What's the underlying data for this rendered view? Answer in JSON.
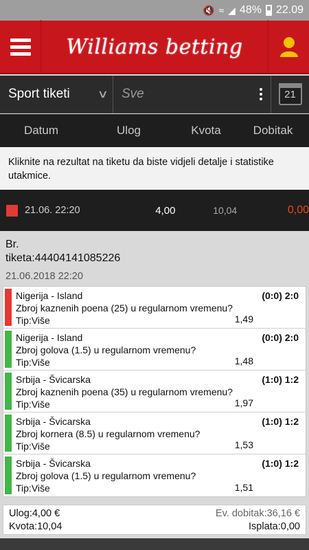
{
  "status_bar": {
    "battery": "48%",
    "time": "22.09"
  },
  "header": {
    "brand": "Williams betting",
    "brand_color": "#c8161d"
  },
  "filter": {
    "sport": "Sport tiketi",
    "placeholder": "Sve",
    "calendar_day": "21"
  },
  "columns": {
    "date": "Datum",
    "stake": "Ulog",
    "odds": "Kvota",
    "winnings": "Dobitak"
  },
  "info_text": "Kliknite na rezultat na tiketu da biste vidjeli detalje i statistike utakmice.",
  "ticket_row": {
    "date": "21.06. 22:20",
    "stake": "4,00",
    "odds": "10,04",
    "winnings": "0,00",
    "status_color": "#e53935"
  },
  "ticket": {
    "number_label": "Br.",
    "number": "tiketa:44404141085226",
    "datetime": "21.06.2018 22:20"
  },
  "bets": [
    {
      "match": "Nigerija - Island",
      "market": "Zbroj kaznenih poena (25) u regularnom vremenu?",
      "tip": "Tip:Više",
      "score": "(0:0) 2:0",
      "odds": "1,49",
      "color": "#e53935"
    },
    {
      "match": "Nigerija - Island",
      "market": "Zbroj golova (1.5) u regularnom vremenu?",
      "tip": "Tip:Više",
      "score": "(0:0) 2:0",
      "odds": "1,48",
      "color": "#43b649"
    },
    {
      "match": "Srbija - Švicarska",
      "market": "Zbroj kaznenih poena (35) u regularnom vremenu?",
      "tip": "Tip:Više",
      "score": "(1:0) 1:2",
      "odds": "1,97",
      "color": "#43b649"
    },
    {
      "match": "Srbija - Švicarska",
      "market": "Zbroj kornera (8.5) u regularnom vremenu?",
      "tip": "Tip:Više",
      "score": "(1:0) 1:2",
      "odds": "1,53",
      "color": "#43b649"
    },
    {
      "match": "Srbija - Švicarska",
      "market": "Zbroj golova (1.5) u regularnom vremenu?",
      "tip": "Tip:Više",
      "score": "(1:0) 1:2",
      "odds": "1,51",
      "color": "#43b649"
    }
  ],
  "summary": {
    "stake": "Ulog:4,00 €",
    "odds": "Kvota:10,04",
    "expected_win": "Ev. dobitak:36,16 €",
    "payout": "Isplata:0,00"
  }
}
